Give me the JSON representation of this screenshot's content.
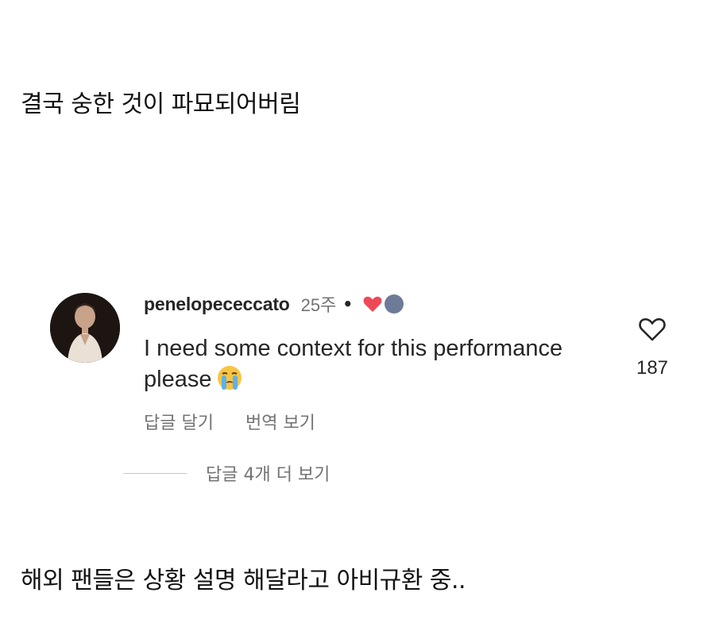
{
  "captions": {
    "top": "결국 숭한 것이 파묘되어버림",
    "bottom": "해외 팬들은 상황 설명 해달라고 아비규환 중.."
  },
  "comment": {
    "username": "penelopececcato",
    "time": "25주",
    "separator": "•",
    "text": "I need some context for this performance please",
    "emoji_icon": "loudly-crying-face-icon",
    "reply_label": "답글 달기",
    "translate_label": "번역 보기",
    "like_count": "187",
    "more_replies_label": "답글 4개 더 보기"
  },
  "colors": {
    "heart_red": "#ed4956",
    "secondary_text": "#737373",
    "primary_text": "#262626"
  }
}
